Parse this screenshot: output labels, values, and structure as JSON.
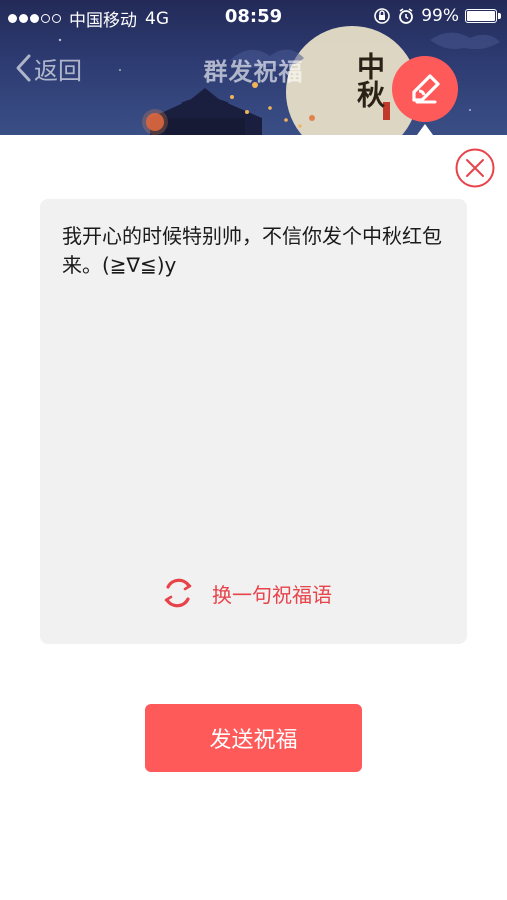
{
  "status_bar": {
    "carrier": "中国移动",
    "network": "4G",
    "time": "08:59",
    "battery": "99%",
    "battery_level": 0.99
  },
  "nav": {
    "back_label": "返回",
    "title": "群发祝福"
  },
  "banner": {
    "calligraphy_text": "中秋"
  },
  "card": {
    "message": "我开心的时候特别帅，不信你发个中秋红包来。(≧∇≦)y",
    "refresh_label": "换一句祝福语"
  },
  "actions": {
    "send_label": "发送祝福"
  },
  "colors": {
    "accent": "#ff5a5a",
    "accent_text": "#e8434b",
    "card_bg": "#f1f1f1",
    "header_bg": "#2d3b72"
  }
}
